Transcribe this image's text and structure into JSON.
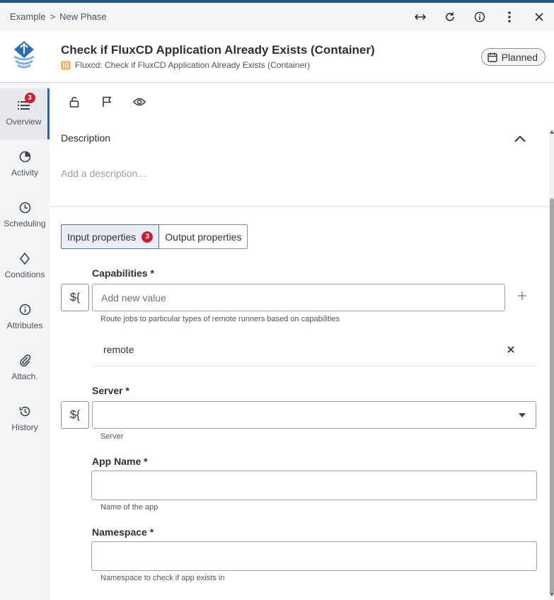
{
  "breadcrumb": {
    "parent": "Example",
    "separator": ">",
    "current": "New Phase"
  },
  "top_icons": [
    "expand-horizontal-icon",
    "refresh-icon",
    "info-icon",
    "more-vertical-icon",
    "close-icon"
  ],
  "header": {
    "title": "Check if FluxCD Application Already Exists (Container)",
    "subtitle": "Fluxcd: Check if FluxCD Application Already Exists (Container)",
    "status": "Planned"
  },
  "sidebar": {
    "items": [
      {
        "label": "Overview",
        "icon": "list-icon",
        "badge": "3",
        "active": true
      },
      {
        "label": "Activity",
        "icon": "activity-icon"
      },
      {
        "label": "Scheduling",
        "icon": "clock-icon"
      },
      {
        "label": "Conditions",
        "icon": "diamond-icon"
      },
      {
        "label": "Attributes",
        "icon": "info-icon"
      },
      {
        "label": "Attach.",
        "icon": "paperclip-icon"
      },
      {
        "label": "History",
        "icon": "history-icon"
      }
    ]
  },
  "toolbar": [
    "lock-icon",
    "flag-icon",
    "eye-icon"
  ],
  "description": {
    "label": "Description",
    "placeholder": "Add a description..."
  },
  "tabs": [
    {
      "label": "Input properties",
      "badge": "3",
      "active": true
    },
    {
      "label": "Output properties"
    }
  ],
  "variable_button": "${",
  "fields": {
    "capabilities": {
      "label": "Capabilities *",
      "placeholder": "Add new value",
      "help": "Route jobs to particular types of remote runners based on capabilities",
      "values": [
        "remote"
      ]
    },
    "server": {
      "label": "Server *",
      "value": "",
      "help": "Server"
    },
    "app_name": {
      "label": "App Name *",
      "value": "",
      "help": "Name of the app"
    },
    "namespace": {
      "label": "Namespace *",
      "value": "",
      "help": "Namespace to check if app exists in"
    }
  },
  "colors": {
    "accent": "#2f6a9c",
    "badge": "#cc1f2d",
    "topbar": "#23567a"
  }
}
